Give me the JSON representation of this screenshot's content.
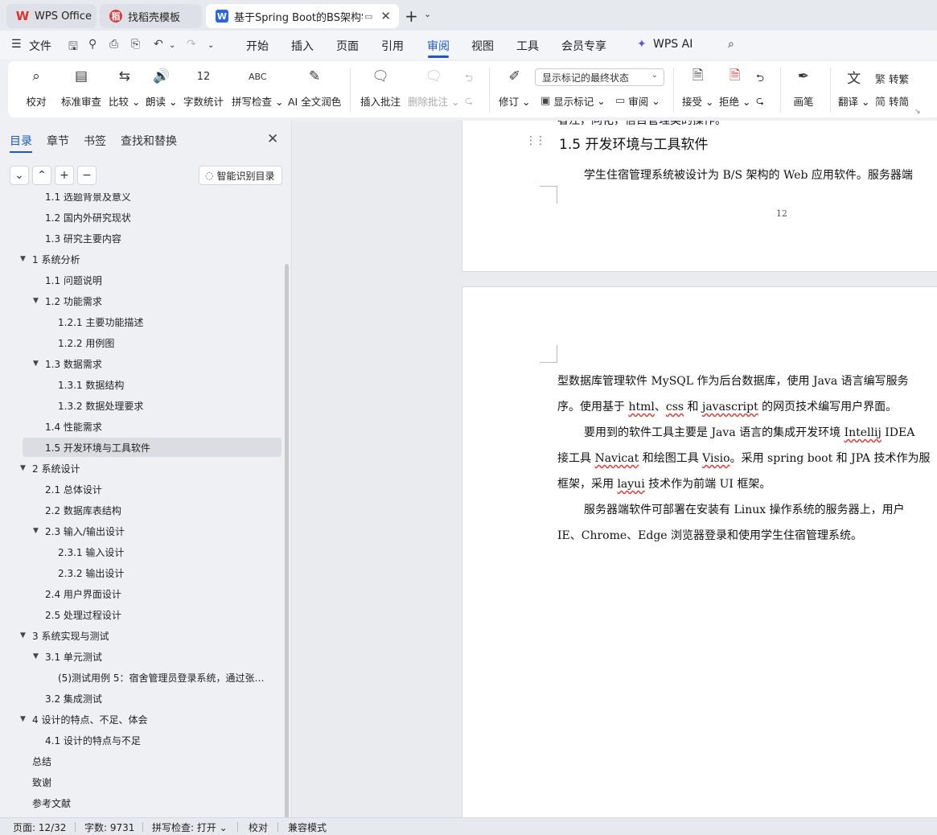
{
  "titlebar": {
    "tabs": [
      {
        "label": "WPS Office",
        "icon": "wps-logo-icon"
      },
      {
        "label": "找稻壳模板",
        "icon": "docer-icon"
      },
      {
        "label": "基于Spring Boot的BS架构学",
        "icon": "writer-doc-icon"
      }
    ],
    "new_tab": "+"
  },
  "menu": {
    "file": "文件",
    "items": [
      "开始",
      "插入",
      "页面",
      "引用",
      "审阅",
      "视图",
      "工具",
      "会员专享"
    ],
    "active": "审阅",
    "wps_ai": "WPS AI"
  },
  "ribbon": {
    "proofread": "校对",
    "standard_review": "标准审查",
    "compare": "比较",
    "read_aloud": "朗读",
    "word_count": "字数统计",
    "spell_check": "拼写检查",
    "ai_polish": "AI 全文润色",
    "insert_comment": "插入批注",
    "delete_comment": "删除批注",
    "track_changes": "修订",
    "markup_mode": "显示标记的最终状态",
    "show_markup": "显示标记",
    "review_pane": "审阅",
    "accept": "接受",
    "reject": "拒绝",
    "pen": "画笔",
    "translate": "翻译",
    "to_traditional": "转繁",
    "to_simplified": "转简"
  },
  "panel": {
    "tabs": [
      "目录",
      "章节",
      "书签",
      "查找和替换"
    ],
    "smart_toc": "智能识别目录",
    "toc": [
      {
        "label": "1.1 选题背景及意义",
        "level": 2,
        "arrow": false
      },
      {
        "label": "1.2 国内外研究现状",
        "level": 2,
        "arrow": false
      },
      {
        "label": "1.3 研究主要内容",
        "level": 2,
        "arrow": false
      },
      {
        "label": "1 系统分析",
        "level": 1,
        "arrow": true
      },
      {
        "label": "1.1 问题说明",
        "level": 2,
        "arrow": false
      },
      {
        "label": "1.2 功能需求",
        "level": 2,
        "arrow": true
      },
      {
        "label": "1.2.1 主要功能描述",
        "level": 3,
        "arrow": false
      },
      {
        "label": "1.2.2 用例图",
        "level": 3,
        "arrow": false
      },
      {
        "label": "1.3 数据需求",
        "level": 2,
        "arrow": true
      },
      {
        "label": "1.3.1 数据结构",
        "level": 3,
        "arrow": false
      },
      {
        "label": "1.3.2 数据处理要求",
        "level": 3,
        "arrow": false
      },
      {
        "label": "1.4 性能需求",
        "level": 2,
        "arrow": false
      },
      {
        "label": "1.5 开发环境与工具软件",
        "level": 2,
        "arrow": false,
        "selected": true
      },
      {
        "label": "2 系统设计",
        "level": 1,
        "arrow": true
      },
      {
        "label": "2.1 总体设计",
        "level": 2,
        "arrow": false
      },
      {
        "label": "2.2 数据库表结构",
        "level": 2,
        "arrow": false
      },
      {
        "label": "2.3 输入/输出设计",
        "level": 2,
        "arrow": true
      },
      {
        "label": "2.3.1 输入设计",
        "level": 3,
        "arrow": false
      },
      {
        "label": "2.3.2 输出设计",
        "level": 3,
        "arrow": false
      },
      {
        "label": "2.4 用户界面设计",
        "level": 2,
        "arrow": false
      },
      {
        "label": "2.5 处理过程设计",
        "level": 2,
        "arrow": false
      },
      {
        "label": "3 系统实现与测试",
        "level": 1,
        "arrow": true
      },
      {
        "label": "3.1 单元测试",
        "level": 2,
        "arrow": true
      },
      {
        "label": "(5)测试用例 5：宿舍管理员登录系统，通过张明 ...",
        "level": 3,
        "arrow": false
      },
      {
        "label": "3.2 集成测试",
        "level": 2,
        "arrow": false
      },
      {
        "label": "4 设计的特点、不足、体会",
        "level": 1,
        "arrow": true
      },
      {
        "label": "4.1 设计的特点与不足",
        "level": 2,
        "arrow": false
      },
      {
        "label": "总结",
        "level": 1,
        "arrow": false
      },
      {
        "label": "致谢",
        "level": 1,
        "arrow": false
      },
      {
        "label": "参考文献",
        "level": 1,
        "arrow": false
      }
    ]
  },
  "document": {
    "cut_line": "者注，同化，信目管理类的操作。",
    "heading": "1.5 开发环境与工具软件",
    "para1": "学生住宿管理系统被设计为 B/S 架构的 Web 应用软件。服务器端",
    "page_number": "12",
    "p2_line1": "型数据库管理软件 MySQL 作为后台数据库，使用 Java 语言编写服务",
    "p2_line2a": "序。使用基于 ",
    "p2_html": "html",
    "p2_sep": "、",
    "p2_css": "css",
    "p2_and": " 和 ",
    "p2_js": "javascript",
    "p2_line2b": " 的网页技术编写用户界面。",
    "p2_line3a": "要用到的软件工具主要是 Java 语言的集成开发环境 ",
    "p2_idea": "Intellij",
    "p2_line3b": " IDEA",
    "p2_line4a": "接工具 ",
    "p2_navicat": "Navicat",
    "p2_line4b": " 和绘图工具 ",
    "p2_visio": "Visio",
    "p2_line4c": "。采用 spring boot 和 JPA 技术作为服",
    "p2_line5a": "框架，采用 ",
    "p2_layui": "layui",
    "p2_line5b": " 技术作为前端 UI 框架。",
    "p2_line6": "服务器端软件可部署在安装有 Linux 操作系统的服务器上，用户",
    "p2_line7": "IE、Chrome、Edge 浏览器登录和使用学生住宿管理系统。"
  },
  "status": {
    "page": "页面: 12/32",
    "words": "字数: 9731",
    "spell": "拼写检查: 打开",
    "proof": "校对",
    "compat": "兼容模式"
  },
  "colors": {
    "accent": "#1a57d6",
    "wps_red": "#e0312a"
  }
}
